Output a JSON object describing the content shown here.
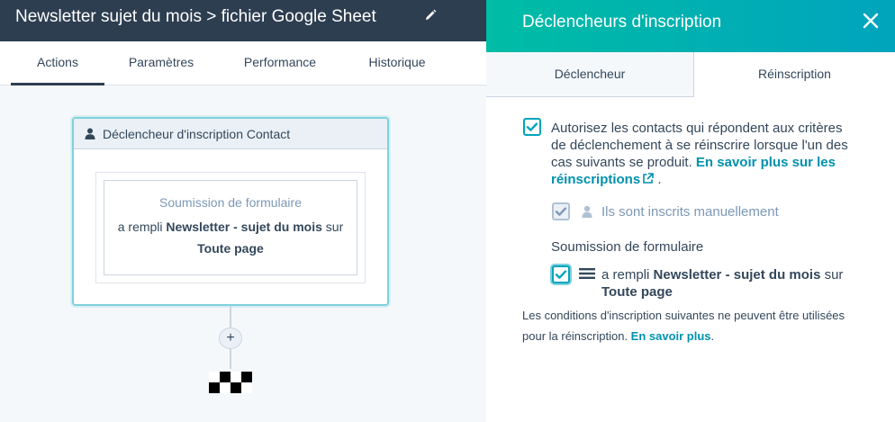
{
  "workflow": {
    "title": "Newsletter sujet du mois > fichier Google Sheet"
  },
  "tabs": [
    {
      "label": "Actions",
      "active": true
    },
    {
      "label": "Paramètres",
      "active": false
    },
    {
      "label": "Performance",
      "active": false
    },
    {
      "label": "Historique",
      "active": false
    }
  ],
  "trigger_card": {
    "header": "Déclencheur d'inscription Contact",
    "filter_type": "Soumission de formulaire",
    "filter_prefix": "a rempli ",
    "form_name": "Newsletter - sujet du mois",
    "filter_middle": " sur",
    "page": "Toute page"
  },
  "add_button": {
    "label": "+"
  },
  "panel": {
    "title": "Déclencheurs d'inscription",
    "tabs": [
      {
        "label": "Déclencheur",
        "active": false
      },
      {
        "label": "Réinscription",
        "active": true
      }
    ],
    "reenroll": {
      "checked": true,
      "text": "Autorisez les contacts qui répondent aux critères de déclenchement à se réinscrire lorsque l'un des cas suivants se produit. ",
      "link": "En savoir plus sur les réinscriptions",
      "after_link": " ."
    },
    "manual": {
      "label": "Ils sont inscrits manuellement",
      "checked": true
    },
    "form_section": {
      "heading": "Soumission de formulaire",
      "prefix": "a rempli ",
      "form_name": "Newsletter - sujet du mois",
      "middle": " sur",
      "page": "Toute page",
      "checked": true
    },
    "note": {
      "text": "Les conditions d'inscription suivantes ne peuvent être utilisées pour la réinscription. ",
      "link": "En savoir plus",
      "after": "."
    }
  },
  "colors": {
    "topbar": "#2d3e50",
    "panel_gradient_start": "#00bda5",
    "panel_gradient_end": "#00a4bd",
    "link": "#0091ae",
    "checkbox": "#00a4bd",
    "card_border": "#7fd1de"
  },
  "icons": {
    "edit": "pencil-icon",
    "contact": "contact-icon",
    "close": "close-icon",
    "external_link": "external-link-icon",
    "form": "form-icon",
    "finish": "finish-flag-icon"
  }
}
